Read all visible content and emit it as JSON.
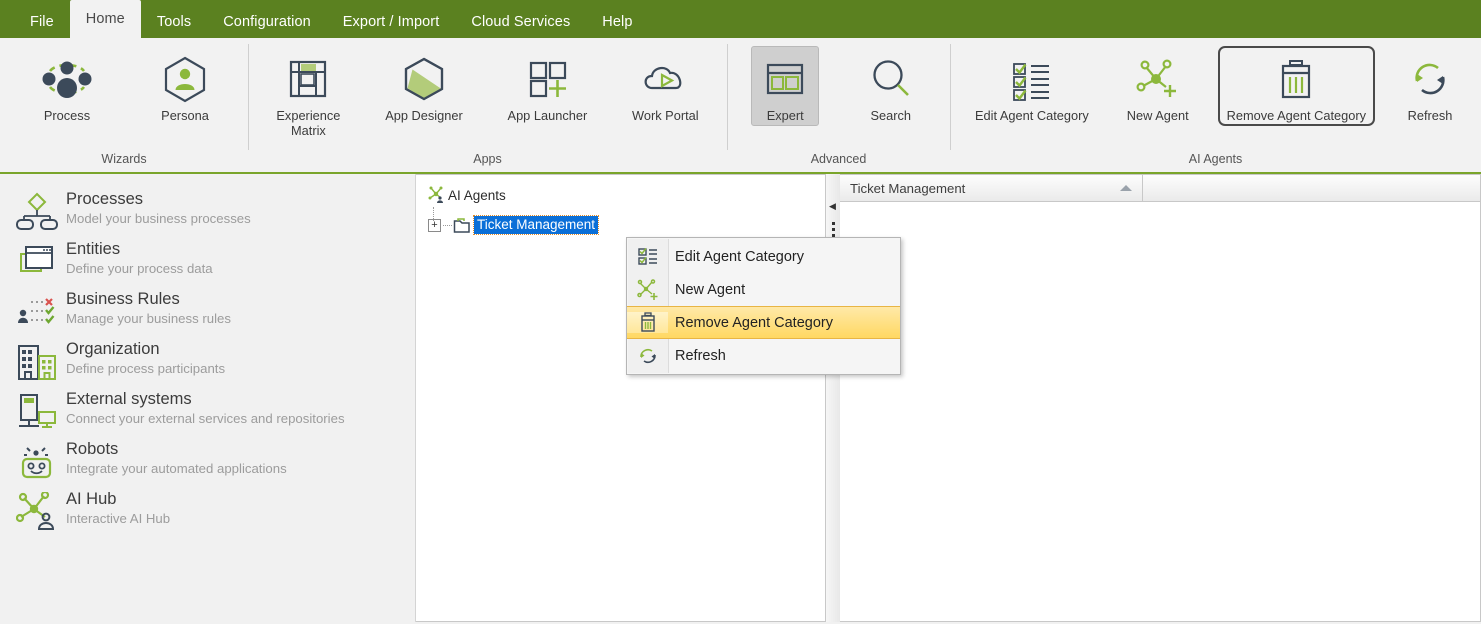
{
  "window": {
    "accent_green": "#5b8120",
    "accent_light_green": "#8cb83c",
    "navy": "#3c4a5a",
    "selection_blue": "#0a6fd8",
    "highlight_yellow": "#ffd862"
  },
  "tabs": [
    {
      "label": "File",
      "name": "tab-file",
      "active": false
    },
    {
      "label": "Home",
      "name": "tab-home",
      "active": true
    },
    {
      "label": "Tools",
      "name": "tab-tools",
      "active": false
    },
    {
      "label": "Configuration",
      "name": "tab-configuration",
      "active": false
    },
    {
      "label": "Export / Import",
      "name": "tab-export-import",
      "active": false
    },
    {
      "label": "Cloud Services",
      "name": "tab-cloud-services",
      "active": false
    },
    {
      "label": "Help",
      "name": "tab-help",
      "active": false
    }
  ],
  "ribbon": {
    "groups": [
      {
        "title": "Wizards",
        "buttons": [
          {
            "label": "Process",
            "icon": "process-network-icon"
          },
          {
            "label": "Persona",
            "icon": "persona-hexagon-icon"
          }
        ]
      },
      {
        "title": "Apps",
        "buttons": [
          {
            "label": "Experience\nMatrix",
            "icon": "experience-matrix-icon"
          },
          {
            "label": "App Designer",
            "icon": "app-designer-hexagon-icon"
          },
          {
            "label": "App Launcher",
            "icon": "app-launcher-grid-plus-icon"
          },
          {
            "label": "Work Portal",
            "icon": "work-portal-cloud-play-icon"
          }
        ]
      },
      {
        "title": "Advanced",
        "buttons": [
          {
            "label": "Expert",
            "icon": "expert-layout-icon",
            "state": "toggled"
          },
          {
            "label": "Search",
            "icon": "search-magnifier-icon"
          }
        ]
      },
      {
        "title": "AI Agents",
        "buttons": [
          {
            "label": "Edit Agent Category",
            "icon": "edit-agent-category-checklist-icon"
          },
          {
            "label": "New Agent",
            "icon": "new-agent-node-plus-icon"
          },
          {
            "label": "Remove Agent Category",
            "icon": "remove-agent-category-trash-icon",
            "state": "focused"
          },
          {
            "label": "Refresh",
            "icon": "refresh-circular-arrow-icon"
          }
        ]
      }
    ]
  },
  "sidebar": {
    "items": [
      {
        "title": "Processes",
        "desc": "Model your business processes",
        "icon": "process-flow-icon"
      },
      {
        "title": "Entities",
        "desc": "Define your process data",
        "icon": "entities-windows-icon"
      },
      {
        "title": "Business  Rules",
        "desc": "Manage your business rules",
        "icon": "business-rules-icon"
      },
      {
        "title": "Organization",
        "desc": "Define process participants",
        "icon": "organization-buildings-icon"
      },
      {
        "title": "External systems",
        "desc": "Connect your external services and repositories",
        "icon": "external-systems-icon"
      },
      {
        "title": "Robots",
        "desc": "Integrate your automated applications",
        "icon": "robot-icon"
      },
      {
        "title": "AI Hub",
        "desc": "Interactive AI Hub",
        "icon": "ai-hub-icon"
      }
    ]
  },
  "tree": {
    "root": {
      "label": "AI Agents",
      "icon": "ai-agents-node-icon"
    },
    "nodes": [
      {
        "label": "Ticket Management",
        "icon": "folder-icon",
        "expander": "+",
        "selected": true
      }
    ]
  },
  "right_panel": {
    "columns": [
      {
        "label": "Ticket Management",
        "sort": "ascending"
      },
      {
        "label": ""
      }
    ]
  },
  "context_menu": {
    "items": [
      {
        "label": "Edit Agent Category",
        "icon": "edit-agent-category-checklist-icon",
        "highlighted": false
      },
      {
        "label": "New Agent",
        "icon": "new-agent-node-plus-icon",
        "highlighted": false
      },
      {
        "label": "Remove Agent Category",
        "icon": "remove-agent-category-trash-icon",
        "highlighted": true
      },
      {
        "label": "Refresh",
        "icon": "refresh-circular-arrow-icon",
        "highlighted": false
      }
    ]
  },
  "splitter": {
    "collapse_up": "◀",
    "collapse_down": "◀"
  }
}
